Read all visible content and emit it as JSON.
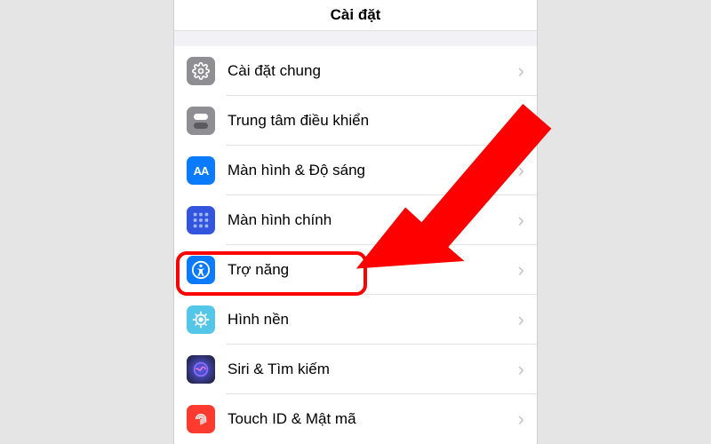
{
  "header": {
    "title": "Cài đặt"
  },
  "rows": {
    "general": {
      "label": "Cài đặt chung"
    },
    "controlcenter": {
      "label": "Trung tâm điều khiển"
    },
    "display": {
      "label": "Màn hình & Độ sáng"
    },
    "homescreen": {
      "label": "Màn hình chính"
    },
    "accessibility": {
      "label": "Trợ năng"
    },
    "wallpaper": {
      "label": "Hình nền"
    },
    "siri": {
      "label": "Siri & Tìm kiếm"
    },
    "touchid": {
      "label": "Touch ID & Mật mã"
    }
  },
  "annotation": {
    "highlight_target": "accessibility"
  }
}
